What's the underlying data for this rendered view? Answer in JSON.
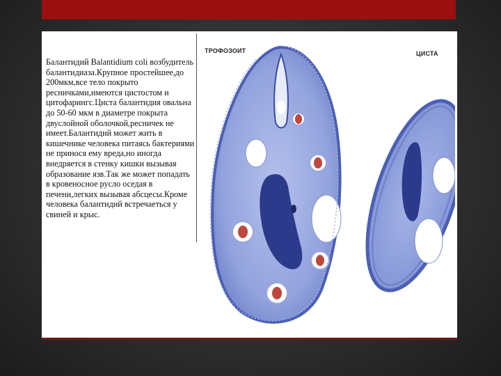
{
  "slide": {
    "body_text": "Балантидий Balantidium coli возбудитель балантидиаза.Крупное простейшее,до 200мкм,все тело покрыто ресничками,имеются цистостом и цитофарингс.Циста балантидия овальна до 50-60 мкм в диаметре покрыта двуслойной оболочкой,ресничек не имеет.Балантидий может жить в кишечнике человека питаясь бактериями не принося ему вреда,но иногда внедряется в стенку кишки вызывая образование язв.Так же может попадать в кровеносное русло оседая в печени,легких вызывая абсцесы.Кроме человека балантидий встречаеться у свиней и крыс."
  },
  "figure": {
    "label_trophozoite": "ТРОФОЗОИТ",
    "label_cyst": "ЦИСТА"
  },
  "colors": {
    "accent_red": "#9a0f0f",
    "cell_blue": "#8f9fdc",
    "nucleus_blue": "#2c3a8c",
    "vacuole_red": "#c0473f"
  }
}
